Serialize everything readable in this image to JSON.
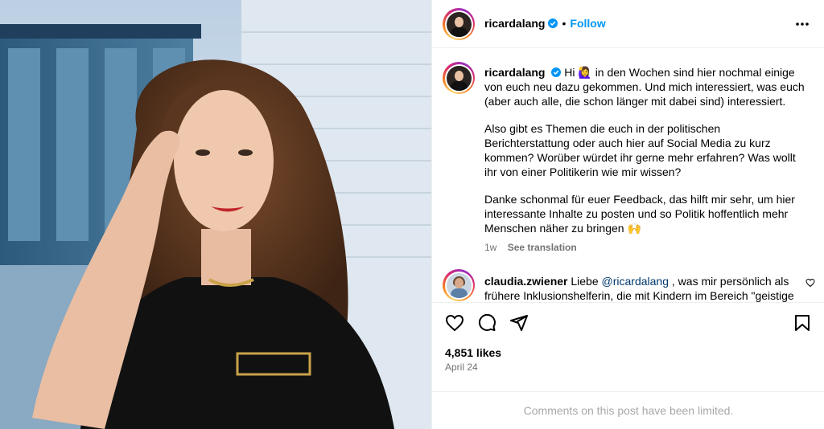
{
  "post": {
    "photo_alt": "Woman with long brown hair in black top, hand raised to hair, city building background"
  },
  "header": {
    "username": "ricardalang",
    "separator": "•",
    "follow_label": "Follow"
  },
  "caption": {
    "username": "ricardalang",
    "para1": "Hi 🙋‍♀️ in den Wochen sind hier nochmal einige von euch neu dazu gekommen. Und mich interessiert, was euch (aber auch alle, die schon länger mit dabei sind) interessiert.",
    "para2": "Also gibt es Themen die euch in der politischen Berichterstattung oder auch hier auf Social Media zu kurz kommen? Worüber würdet ihr gerne mehr erfahren? Was wollt ihr von einer Politikerin wie mir wissen?",
    "para3": "Danke schonmal für euer Feedback, das hilft mir sehr, um hier interessante Inhalte zu posten und so Politik hoffentlich mehr Menschen näher zu bringen 🙌",
    "age": "1w",
    "see_translation": "See translation"
  },
  "comment": {
    "username": "claudia.zwiener",
    "lead": "Liebe",
    "mention": "@ricardalang",
    "text": ", was mir persönlich als frühere Inklusionshelferin, die mit Kindern im Bereich \"geistige"
  },
  "stats": {
    "likes": "4,851 likes",
    "date": "April 24"
  },
  "footer": {
    "limited_text": "Comments on this post have been limited."
  },
  "colors": {
    "accent": "#0095f6",
    "verified": "#0095f6",
    "muted": "#737373",
    "mention": "#00376b"
  }
}
